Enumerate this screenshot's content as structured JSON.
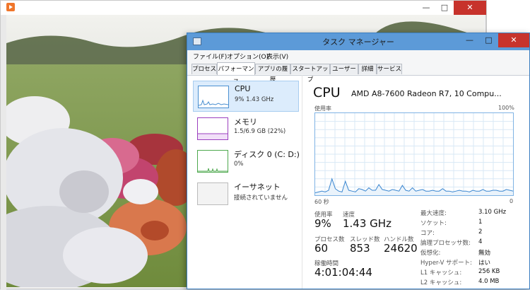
{
  "bg_window": {
    "controls": [
      "—",
      "□",
      "✕"
    ]
  },
  "tm": {
    "title": "タスク マネージャー",
    "controls": [
      "—",
      "□",
      "✕"
    ],
    "menu": [
      "ファイル(F)",
      "オプション(O)",
      "表示(V)"
    ],
    "tabs": [
      "プロセス",
      "パフォーマンス",
      "アプリの履歴",
      "スタートアップ",
      "ユーザー",
      "詳細",
      "サービス"
    ],
    "active_tab": "パフォーマンス"
  },
  "resources": [
    {
      "name": "CPU",
      "value": "9% 1.43 GHz",
      "color": "#4a8fd0"
    },
    {
      "name": "メモリ",
      "value": "1.5/6.9 GB (22%)",
      "color": "#9b3fbf"
    },
    {
      "name": "ディスク 0 (C: D:)",
      "value": "0%",
      "color": "#4da84d"
    },
    {
      "name": "イーサネット",
      "value": "接続されていません",
      "color": "#a0a0a0"
    }
  ],
  "detail": {
    "title": "CPU",
    "model": "AMD A8-7600 Radeon R7, 10 Compu...",
    "usage_label": "使用率",
    "max_label": "100%",
    "time_label": "60 秒",
    "zero_label": "0",
    "stats": {
      "usage": {
        "label": "使用率",
        "value": "9%"
      },
      "speed": {
        "label": "速度",
        "value": "1.43 GHz"
      },
      "processes": {
        "label": "プロセス数",
        "value": "60"
      },
      "threads": {
        "label": "スレッド数",
        "value": "853"
      },
      "handles": {
        "label": "ハンドル数",
        "value": "24620"
      },
      "uptime": {
        "label": "稼働時間",
        "value": "4:01:04:44"
      }
    },
    "specs": [
      {
        "k": "最大速度:",
        "v": "3.10 GHz"
      },
      {
        "k": "ソケット:",
        "v": "1"
      },
      {
        "k": "コア:",
        "v": "2"
      },
      {
        "k": "論理プロセッサ数:",
        "v": "4"
      },
      {
        "k": "仮想化:",
        "v": "無効"
      },
      {
        "k": "Hyper-V サポート:",
        "v": "はい"
      },
      {
        "k": "L1 キャッシュ:",
        "v": "256 KB"
      },
      {
        "k": "L2 キャッシュ:",
        "v": "4.0 MB"
      }
    ]
  },
  "cpu_history": [
    3,
    4,
    5,
    4,
    6,
    20,
    8,
    5,
    4,
    17,
    6,
    5,
    4,
    8,
    7,
    5,
    9,
    6,
    6,
    13,
    7,
    6,
    5,
    7,
    6,
    5,
    12,
    6,
    5,
    9,
    5,
    6,
    7,
    5,
    5,
    6,
    5,
    5,
    8,
    5,
    5,
    4,
    5,
    6,
    5,
    5,
    4,
    6,
    5,
    5,
    7,
    5,
    5,
    6,
    6,
    5,
    5,
    7,
    6,
    5
  ]
}
